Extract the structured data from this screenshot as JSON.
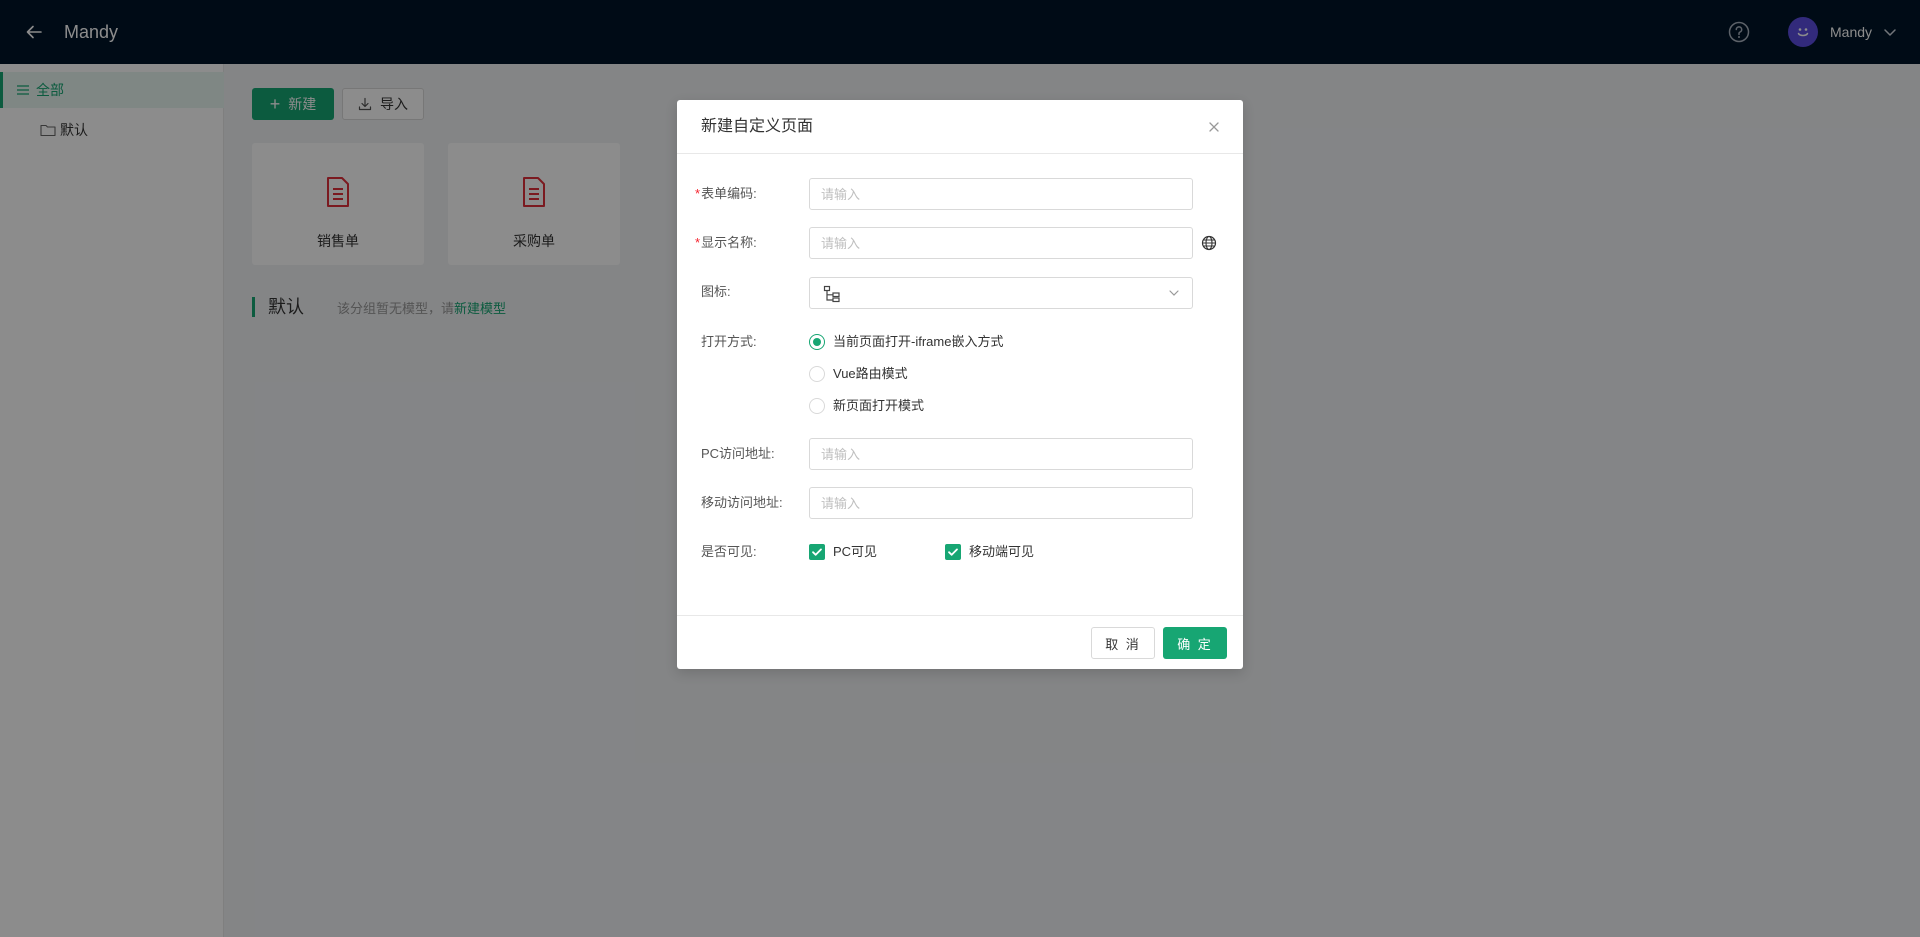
{
  "header": {
    "title": "Mandy",
    "user_name": "Mandy"
  },
  "sidebar": {
    "items": [
      {
        "label": "全部"
      },
      {
        "label": "默认"
      }
    ]
  },
  "toolbar": {
    "new_label": "新建",
    "import_label": "导入"
  },
  "cards": [
    {
      "label": "销售单",
      "icon": "document-icon"
    },
    {
      "label": "采购单",
      "icon": "document-icon"
    }
  ],
  "section": {
    "title": "默认",
    "hint": "该分组暂无模型，请",
    "link": "新建模型"
  },
  "modal": {
    "title": "新建自定义页面",
    "fields": {
      "form_code": {
        "label": "表单编码:",
        "required_mark": "*",
        "placeholder": "请输入",
        "value": ""
      },
      "display_name": {
        "label": "显示名称:",
        "required_mark": "*",
        "placeholder": "请输入",
        "value": ""
      },
      "icon": {
        "label": "图标:",
        "selected_icon": "org-tree-icon"
      },
      "open_mode": {
        "label": "打开方式:",
        "options": [
          {
            "label": "当前页面打开-iframe嵌入方式",
            "checked": true
          },
          {
            "label": "Vue路由模式",
            "checked": false
          },
          {
            "label": "新页面打开模式",
            "checked": false
          }
        ]
      },
      "pc_url": {
        "label": "PC访问地址:",
        "placeholder": "请输入",
        "value": ""
      },
      "mobile_url": {
        "label": "移动访问地址:",
        "placeholder": "请输入",
        "value": ""
      },
      "visible": {
        "label": "是否可见:",
        "options": [
          {
            "label": "PC可见",
            "checked": true
          },
          {
            "label": "移动端可见",
            "checked": true
          }
        ]
      }
    },
    "cancel_label": "取 消",
    "ok_label": "确 定"
  },
  "colors": {
    "primary": "#17a673",
    "header_bg": "#001529",
    "danger": "#f5222d",
    "avatar_bg": "#5b4de0"
  }
}
